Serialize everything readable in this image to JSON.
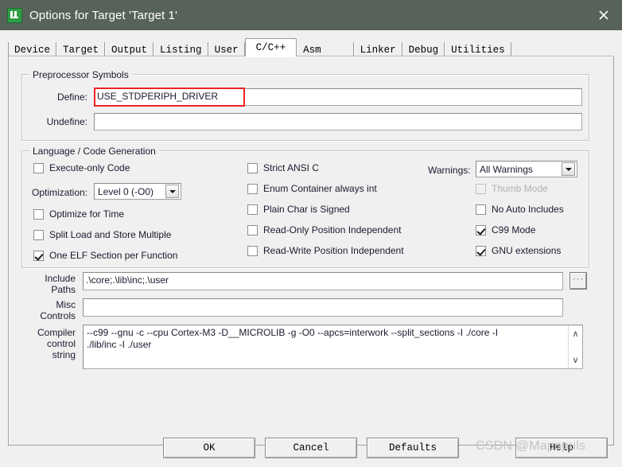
{
  "window": {
    "title": "Options for Target 'Target 1'",
    "icon": "keil-uvision-icon",
    "close_label": "✕"
  },
  "tabs": [
    {
      "label": "Device",
      "active": false
    },
    {
      "label": "Target",
      "active": false
    },
    {
      "label": "Output",
      "active": false
    },
    {
      "label": "Listing",
      "active": false
    },
    {
      "label": "User",
      "active": false
    },
    {
      "label": "C/C++",
      "active": true
    },
    {
      "label": "Asm",
      "active": false
    },
    {
      "label": "Linker",
      "active": false
    },
    {
      "label": "Debug",
      "active": false
    },
    {
      "label": "Utilities",
      "active": false
    }
  ],
  "preprocessor": {
    "legend": "Preprocessor Symbols",
    "define_label": "Define:",
    "define_value": "USE_STDPERIPH_DRIVER",
    "undefine_label": "Undefine:",
    "undefine_value": "",
    "highlight_color": "#ee2222"
  },
  "language": {
    "legend": "Language / Code Generation",
    "col1": [
      {
        "label": "Execute-only Code",
        "checked": false,
        "disabled": false
      },
      {
        "label": "Optimize for Time",
        "checked": false,
        "disabled": false
      },
      {
        "label": "Split Load and Store Multiple",
        "checked": false,
        "disabled": false
      },
      {
        "label": "One ELF Section per Function",
        "checked": true,
        "disabled": false
      }
    ],
    "optimization_label": "Optimization:",
    "optimization_value": "Level 0 (-O0)",
    "col2": [
      {
        "label": "Strict ANSI C",
        "checked": false,
        "disabled": false
      },
      {
        "label": "Enum Container always int",
        "checked": false,
        "disabled": false
      },
      {
        "label": "Plain Char is Signed",
        "checked": false,
        "disabled": false
      },
      {
        "label": "Read-Only Position Independent",
        "checked": false,
        "disabled": false
      },
      {
        "label": "Read-Write Position Independent",
        "checked": false,
        "disabled": false
      }
    ],
    "warnings_label": "Warnings:",
    "warnings_value": "All Warnings",
    "col3": [
      {
        "label": "Thumb Mode",
        "checked": false,
        "disabled": true
      },
      {
        "label": "No Auto Includes",
        "checked": false,
        "disabled": false
      },
      {
        "label": "C99 Mode",
        "checked": true,
        "disabled": false
      },
      {
        "label": "GNU extensions",
        "checked": true,
        "disabled": false
      }
    ]
  },
  "paths": {
    "include_label_line1": "Include",
    "include_label_line2": "Paths",
    "include_value": ".\\core;.\\lib\\inc;.\\user",
    "browse_label": "···",
    "misc_label_line1": "Misc",
    "misc_label_line2": "Controls",
    "misc_value": ""
  },
  "compiler": {
    "label_line1": "Compiler",
    "label_line2": "control",
    "label_line3": "string",
    "value_line1": "--c99 --gnu -c --cpu Cortex-M3 -D__MICROLIB -g -O0 --apcs=interwork --split_sections -I ./core -I",
    "value_line2": "./lib/inc -I ./user",
    "scroll_up": "∧",
    "scroll_down": "∨"
  },
  "buttons": {
    "ok": "OK",
    "cancel": "Cancel",
    "defaults": "Defaults",
    "help": "Help"
  },
  "watermark": {
    "text": "CSDN @Mapopuls"
  }
}
